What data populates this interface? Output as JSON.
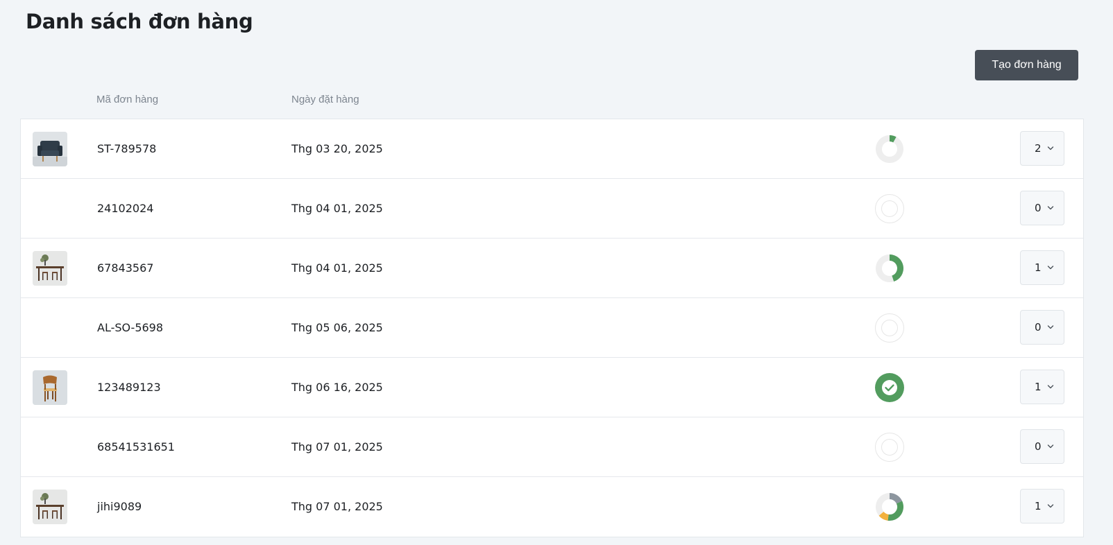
{
  "header": {
    "title": "Danh sách đơn hàng",
    "create_button": "Tạo đơn hàng"
  },
  "table": {
    "columns": [
      "Mã đơn hàng",
      "Ngày đặt hàng"
    ],
    "rows": [
      {
        "code": "ST-789578",
        "date": "Thg 03 20, 2025",
        "quantity": "2",
        "thumbnail": "armchair",
        "status": {
          "type": "partial",
          "fraction": 0.08,
          "color": "#529c5e"
        }
      },
      {
        "code": "24102024",
        "date": "Thg 04 01, 2025",
        "quantity": "0",
        "thumbnail": null,
        "status": {
          "type": "empty"
        }
      },
      {
        "code": "67843567",
        "date": "Thg 04 01, 2025",
        "quantity": "1",
        "thumbnail": "dining-set",
        "status": {
          "type": "partial",
          "fraction": 0.45,
          "color": "#529c5e"
        }
      },
      {
        "code": "AL-SO-5698",
        "date": "Thg 05 06, 2025",
        "quantity": "0",
        "thumbnail": null,
        "status": {
          "type": "empty"
        }
      },
      {
        "code": "123489123",
        "date": "Thg 06 16, 2025",
        "quantity": "1",
        "thumbnail": "wooden-chair",
        "status": {
          "type": "complete",
          "color": "#529c5e"
        }
      },
      {
        "code": "68541531651",
        "date": "Thg 07 01, 2025",
        "quantity": "0",
        "thumbnail": null,
        "status": {
          "type": "empty"
        }
      },
      {
        "code": "jihi9089",
        "date": "Thg 07 01, 2025",
        "quantity": "1",
        "thumbnail": "dining-set",
        "status": {
          "type": "multi",
          "segments": [
            {
              "fraction": 0.18,
              "color": "#8d969f"
            },
            {
              "fraction": 0.34,
              "color": "#529c5e"
            },
            {
              "fraction": 0.12,
              "color": "#f2b13d"
            }
          ]
        }
      }
    ]
  },
  "colors": {
    "accent_button": "#474e57",
    "status_green": "#529c5e",
    "status_gray": "#8d969f",
    "status_yellow": "#f2b13d",
    "ring_track": "#eeeeee"
  }
}
